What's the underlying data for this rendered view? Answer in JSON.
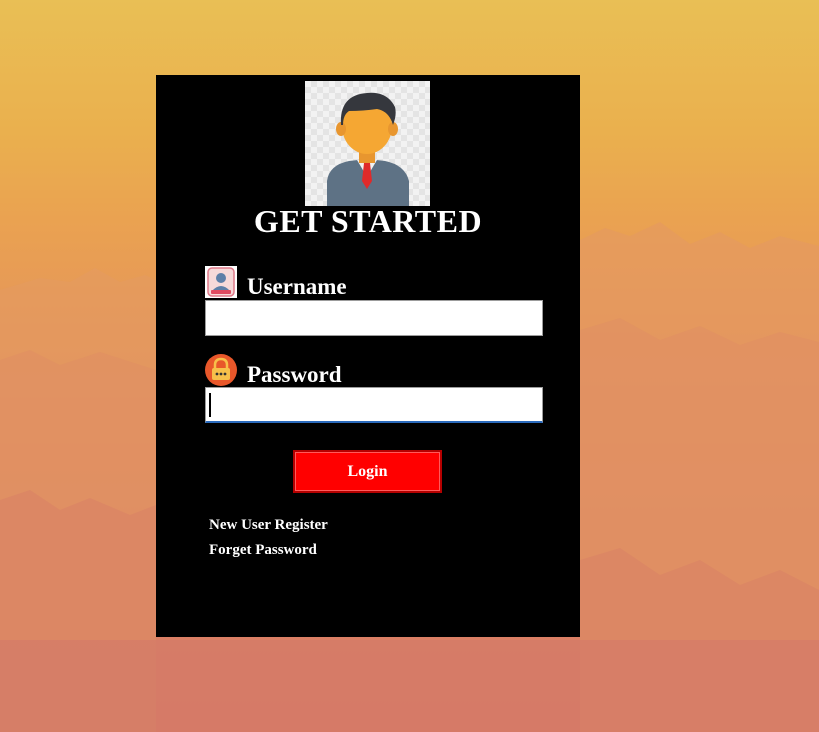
{
  "login": {
    "title": "GET STARTED",
    "username": {
      "label": "Username",
      "icon": "user-badge-icon",
      "value": "",
      "placeholder": ""
    },
    "password": {
      "label": "Password",
      "icon": "padlock-icon",
      "value": "",
      "placeholder": ""
    },
    "login_button": "Login",
    "links": {
      "register": "New User Register",
      "forget": "Forget Password"
    }
  },
  "icons": {
    "avatar": "user-avatar-icon"
  },
  "colors": {
    "panel": "#000000",
    "button": "#ff0000",
    "text": "#ffffff",
    "focus_underline": "#2b6bbd"
  }
}
